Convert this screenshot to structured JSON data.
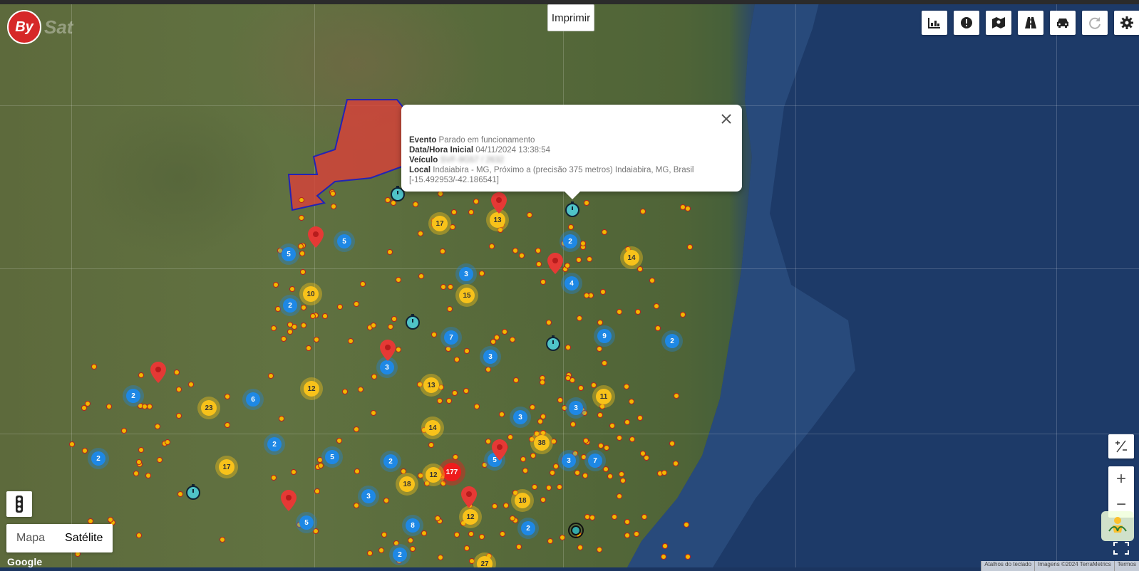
{
  "app": {
    "logo_mark": "By",
    "logo_word": "Sat"
  },
  "print_button": "Imprimir",
  "toolbar": {
    "icons": [
      "chart-icon",
      "alert-icon",
      "map-route-icon",
      "road-icon",
      "car-icon",
      "refresh-icon",
      "gear-icon"
    ]
  },
  "popup": {
    "event_label": "Evento",
    "event_value": "Parado em funcionamento",
    "datetime_label": "Data/Hora Inicial",
    "datetime_value": "04/11/2024 13:38:54",
    "vehicle_label": "Veículo",
    "vehicle_value": "SVF-9G57 / 2632",
    "location_label": "Local",
    "location_value": "Indaiabira - MG, Próximo a (precisão 375 metros) Indaiabira, MG, Brasil",
    "coords": "[-15.492953/-42.186541]"
  },
  "clusters": [
    {
      "c": "blue",
      "n": "5"
    },
    {
      "c": "blue",
      "n": "5"
    },
    {
      "c": "yellow",
      "n": "17"
    },
    {
      "c": "yellow",
      "n": "13"
    },
    {
      "c": "blue",
      "n": "2"
    },
    {
      "c": "yellow",
      "n": "14"
    },
    {
      "c": "blue",
      "n": "3"
    },
    {
      "c": "yellow",
      "n": "10"
    },
    {
      "c": "blue",
      "n": "2"
    },
    {
      "c": "yellow",
      "n": "15"
    },
    {
      "c": "blue",
      "n": "4"
    },
    {
      "c": "blue",
      "n": "7"
    },
    {
      "c": "blue",
      "n": "9"
    },
    {
      "c": "blue",
      "n": "2"
    },
    {
      "c": "blue",
      "n": "3"
    },
    {
      "c": "blue",
      "n": "3"
    },
    {
      "c": "yellow",
      "n": "13"
    },
    {
      "c": "blue",
      "n": "2"
    },
    {
      "c": "blue",
      "n": "6"
    },
    {
      "c": "yellow",
      "n": "12"
    },
    {
      "c": "yellow",
      "n": "23"
    },
    {
      "c": "yellow",
      "n": "11"
    },
    {
      "c": "blue",
      "n": "3"
    },
    {
      "c": "blue",
      "n": "3"
    },
    {
      "c": "yellow",
      "n": "14"
    },
    {
      "c": "yellow",
      "n": "38"
    },
    {
      "c": "blue",
      "n": "2"
    },
    {
      "c": "blue",
      "n": "2"
    },
    {
      "c": "blue",
      "n": "5"
    },
    {
      "c": "yellow",
      "n": "17"
    },
    {
      "c": "blue",
      "n": "2"
    },
    {
      "c": "red",
      "n": "177"
    },
    {
      "c": "blue",
      "n": "5"
    },
    {
      "c": "blue",
      "n": "3"
    },
    {
      "c": "blue",
      "n": "7"
    },
    {
      "c": "yellow",
      "n": "12"
    },
    {
      "c": "yellow",
      "n": "18"
    },
    {
      "c": "blue",
      "n": "3"
    },
    {
      "c": "yellow",
      "n": "18"
    },
    {
      "c": "yellow",
      "n": "12"
    },
    {
      "c": "blue",
      "n": "5"
    },
    {
      "c": "blue",
      "n": "8"
    },
    {
      "c": "blue",
      "n": "2"
    },
    {
      "c": "blue",
      "n": "2"
    },
    {
      "c": "yellow",
      "n": "27"
    }
  ],
  "map_type": {
    "map": "Mapa",
    "satellite": "Satélite",
    "active": "Satélite"
  },
  "zoom": {
    "in": "+",
    "out": "−"
  },
  "google_label": "Google",
  "attribution": {
    "shortcuts": "Atalhos do teclado",
    "imagery": "Imagens ©2024 TerraMetrics",
    "terms": "Termos"
  },
  "colors": {
    "cluster_blue": "#1e88e5",
    "cluster_yellow": "#f8c21a",
    "cluster_red": "#ee1c1c",
    "geofence": "#d9413a",
    "geofence_border": "#2323b5",
    "brand": "#d62828"
  }
}
